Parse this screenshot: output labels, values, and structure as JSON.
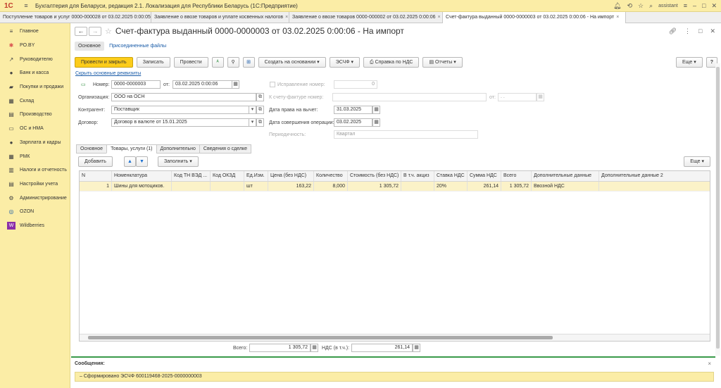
{
  "app": {
    "logo": "1С",
    "title": "Бухгалтерия для Беларуси, редакция 2.1. Локализация для Республики Беларусь  (1С:Предприятие)",
    "user": "assistant"
  },
  "tabs": [
    {
      "label": "Поступление товаров и услуг 0000-000028 от 03.02.2025 0:00:05"
    },
    {
      "label": "Заявление о ввозе товаров и уплате косвенных налогов"
    },
    {
      "label": "Заявление о ввозе товаров 0000-000002 от 03.02.2025 0:00:06"
    },
    {
      "label": "Счет-фактура выданный 0000-0000003 от 03.02.2025 0:00:06 - На импорт"
    }
  ],
  "sidebar": {
    "items": [
      {
        "label": "Главное",
        "icon": "≡"
      },
      {
        "label": "PO.BY",
        "icon": "✱"
      },
      {
        "label": "Руководителю",
        "icon": "↗"
      },
      {
        "label": "Банк и касса",
        "icon": "●"
      },
      {
        "label": "Покупки и продажи",
        "icon": "▰"
      },
      {
        "label": "Склад",
        "icon": "▦"
      },
      {
        "label": "Производство",
        "icon": "▤"
      },
      {
        "label": "ОС и НМА",
        "icon": "▭"
      },
      {
        "label": "Зарплата и кадры",
        "icon": "●"
      },
      {
        "label": "РМК",
        "icon": "▦"
      },
      {
        "label": "Налоги и отчетность",
        "icon": "▥"
      },
      {
        "label": "Настройки учета",
        "icon": "▤"
      },
      {
        "label": "Администрирование",
        "icon": "⚙"
      },
      {
        "label": "OZON",
        "icon": "◎"
      },
      {
        "label": "Wildberries",
        "icon": "W"
      }
    ]
  },
  "doc": {
    "title": "Счет-фактура выданный 0000-0000003 от 03.02.2025 0:00:06 - На импорт"
  },
  "subnav": {
    "main": "Основное",
    "files": "Присоединенные файлы"
  },
  "toolbar": {
    "post_close": "Провести и закрыть",
    "save": "Записать",
    "post": "Провести",
    "create_based": "Создать на основании",
    "escf": "ЭСЧФ",
    "vat_ref": "Справка по НДС",
    "reports": "Отчеты",
    "more": "Еще",
    "help": "?"
  },
  "hide_link": "Скрыть основные реквизиты",
  "form": {
    "number_label": "Номер:",
    "number": "0000-0000003",
    "from_label": "от:",
    "date": "03.02.2025  0:00:06",
    "correction_label": "Исправление номер:",
    "correction_value": "0",
    "org_label": "Организация:",
    "org": "ООО на ОСН",
    "to_invoice_label": "К счету-фактуре номер:",
    "to_invoice_from": "от:",
    "to_invoice_date": ". .",
    "contractor_label": "Контрагент:",
    "contractor": "Поставщик",
    "deduction_label": "Дата права на вычет:",
    "deduction_date": "31.03.2025",
    "contract_label": "Договор:",
    "contract": "Договор в валюте от 15.01.2025",
    "op_date_label": "Дата совершения операции:",
    "op_date": "03.02.2025",
    "period_label": "Периодичность:",
    "period": "Квартал"
  },
  "form_tabs": [
    "Основное",
    "Товары, услуги (1)",
    "Дополнительно",
    "Сведения о сделке"
  ],
  "table_toolbar": {
    "add": "Добавить",
    "up": "▲",
    "down": "▼",
    "fill": "Заполнить",
    "more": "Еще"
  },
  "table": {
    "columns": [
      "N",
      "Номенклатура",
      "Код ТН ВЭД ...",
      "Код ОКЗД",
      "Ед.Изм.",
      "Цена (без НДС)",
      "Количество",
      "Стоимость (без НДС)",
      "В т.ч. акциз",
      "Ставка НДС",
      "Сумма НДС",
      "Всего",
      "Дополнительные данные",
      "Дополнительные данные 2"
    ],
    "rows": [
      [
        "1",
        "Шины для мотоциков.",
        "",
        "",
        "шт",
        "163,22",
        "8,000",
        "1 305,72",
        "",
        "20%",
        "261,14",
        "1 305,72",
        "Ввозной НДС",
        ""
      ]
    ]
  },
  "totals": {
    "total_label": "Всего:",
    "total": "1 305,72",
    "vat_label": "НДС (в т.ч.):",
    "vat": "261,14"
  },
  "messages": {
    "title": "Сообщения:",
    "text": "–  Сформировано ЭСЧФ 600119468-2025-0000000003"
  }
}
